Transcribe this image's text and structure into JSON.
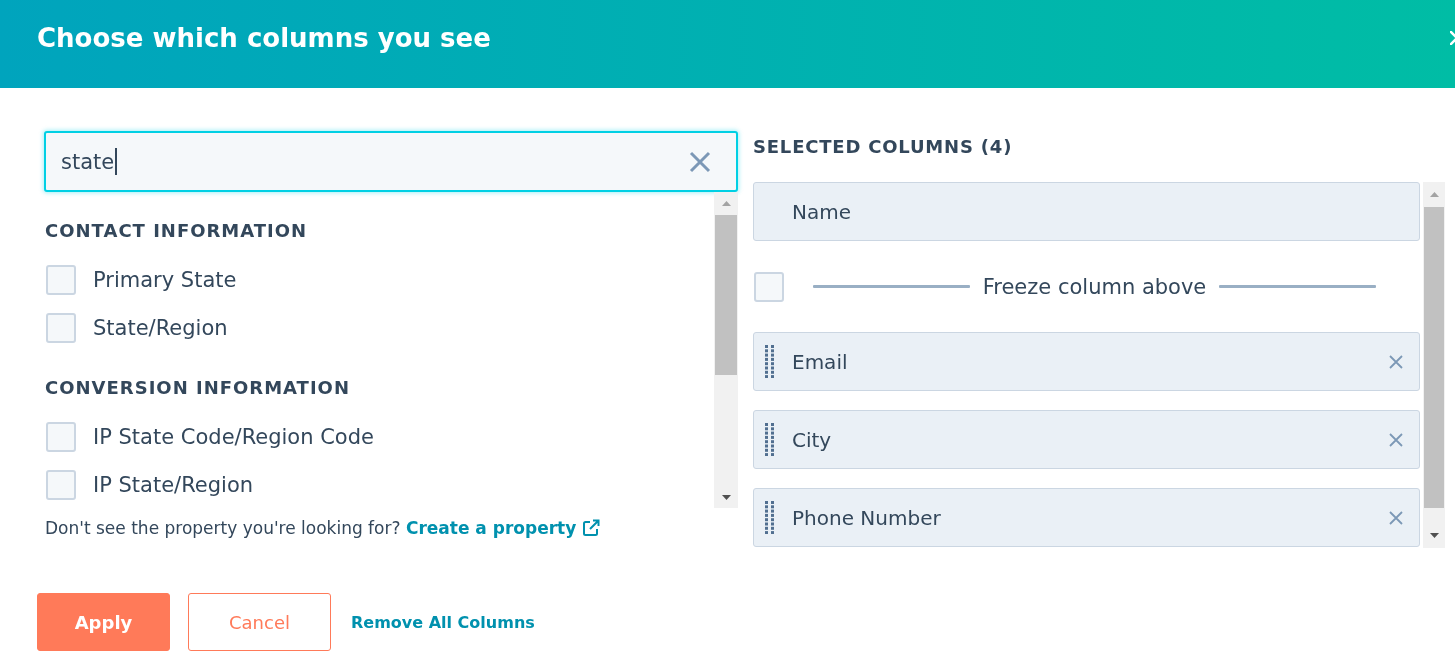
{
  "dialog": {
    "title": "Choose which columns you see"
  },
  "search": {
    "value": "state",
    "focused": true
  },
  "property_groups": [
    {
      "heading": "CONTACT INFORMATION",
      "items": [
        {
          "label": "Primary State",
          "checked": false
        },
        {
          "label": "State/Region",
          "checked": false
        }
      ]
    },
    {
      "heading": "CONVERSION INFORMATION",
      "items": [
        {
          "label": "IP State Code/Region Code",
          "checked": false
        },
        {
          "label": "IP State/Region",
          "checked": false
        }
      ]
    }
  ],
  "hint": {
    "text": "Don't see the property you're looking for?",
    "link": "Create a property"
  },
  "selected_columns": {
    "heading": "SELECTED COLUMNS (4)",
    "columns": [
      {
        "label": "Name",
        "kind": "fixed"
      },
      {
        "label": "Email",
        "kind": "movable"
      },
      {
        "label": "City",
        "kind": "movable"
      },
      {
        "label": "Phone Number",
        "kind": "movable"
      }
    ],
    "freeze": {
      "label": "Freeze column above",
      "checked": false
    }
  },
  "footer": {
    "buttons": [
      {
        "label": "Apply",
        "kind": "primary"
      },
      {
        "label": "Cancel",
        "kind": "secondary"
      }
    ],
    "link": "Remove All Columns"
  }
}
